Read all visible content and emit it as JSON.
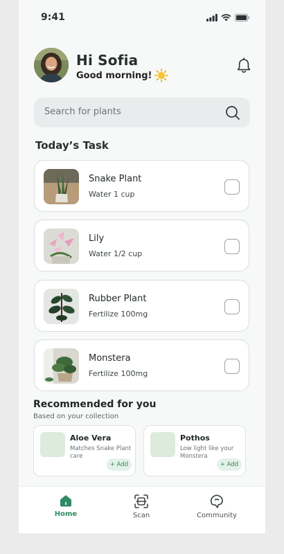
{
  "status_bar": {
    "time": "9:41",
    "icons": [
      "signal-icon",
      "wifi-icon",
      "battery-icon"
    ]
  },
  "header": {
    "greeting": "Hi Sofia",
    "subtitle": "Good morning!",
    "emoji_icon": "sun-icon",
    "notification_icon": "bell-icon"
  },
  "search": {
    "placeholder": "Search for plants",
    "icon": "search-icon"
  },
  "tasks": {
    "title": "Today’s Task",
    "items": [
      {
        "name": "Snake Plant",
        "action": "Water 1 cup",
        "done": false
      },
      {
        "name": "Lily",
        "action": "Water 1/2 cup",
        "done": false
      },
      {
        "name": "Rubber Plant",
        "action": "Fertilize 100mg",
        "done": false
      },
      {
        "name": "Monstera",
        "action": "Fertilize 100mg",
        "done": false
      }
    ]
  },
  "recommended": {
    "title": "Recommended for you",
    "subtitle": "Based on your collection",
    "items": [
      {
        "name": "Aloe Vera",
        "desc": "Matches Snake Plant care",
        "add_label": "+ Add"
      },
      {
        "name": "Pothos",
        "desc": "Low light like your Monstera",
        "add_label": "+ Add"
      }
    ]
  },
  "nav": {
    "items": [
      {
        "label": "Home",
        "icon": "home-icon",
        "active": true
      },
      {
        "label": "Scan",
        "icon": "scan-icon",
        "active": false
      },
      {
        "label": "Community",
        "icon": "chat-icon",
        "active": false
      }
    ]
  },
  "colors": {
    "accent": "#2e8b63",
    "background": "#f7f9f8",
    "card_border": "#d9dedc"
  }
}
